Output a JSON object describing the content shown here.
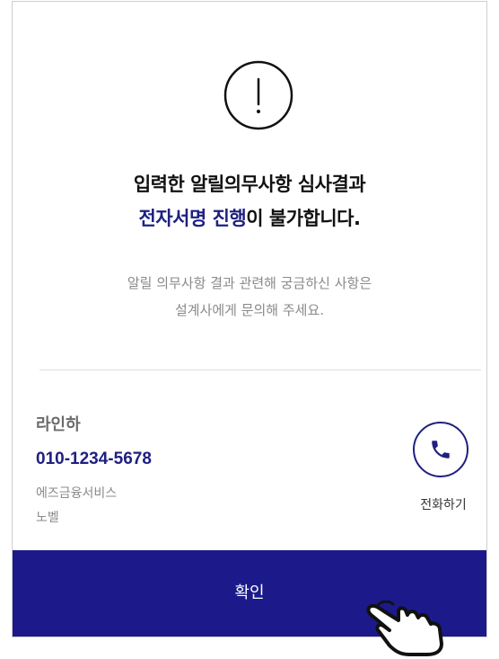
{
  "headline": {
    "line1": "입력한 알릴의무사항 심사결과",
    "line2_accent": "전자서명 진행",
    "line2_rest": "이 불가합니다."
  },
  "message": {
    "line1": "알릴 의무사항 결과 관련해 궁금하신 사항은",
    "line2": "설계사에게 문의해 주세요."
  },
  "agent": {
    "name": "라인하",
    "phone": "010-1234-5678",
    "company": "에즈금융서비스",
    "grade": "노벨"
  },
  "call_button": {
    "label": "전화하기"
  },
  "confirm_button": {
    "label": "확인"
  },
  "colors": {
    "accent": "#1f2080",
    "confirm_bg": "#1c1a8a"
  }
}
